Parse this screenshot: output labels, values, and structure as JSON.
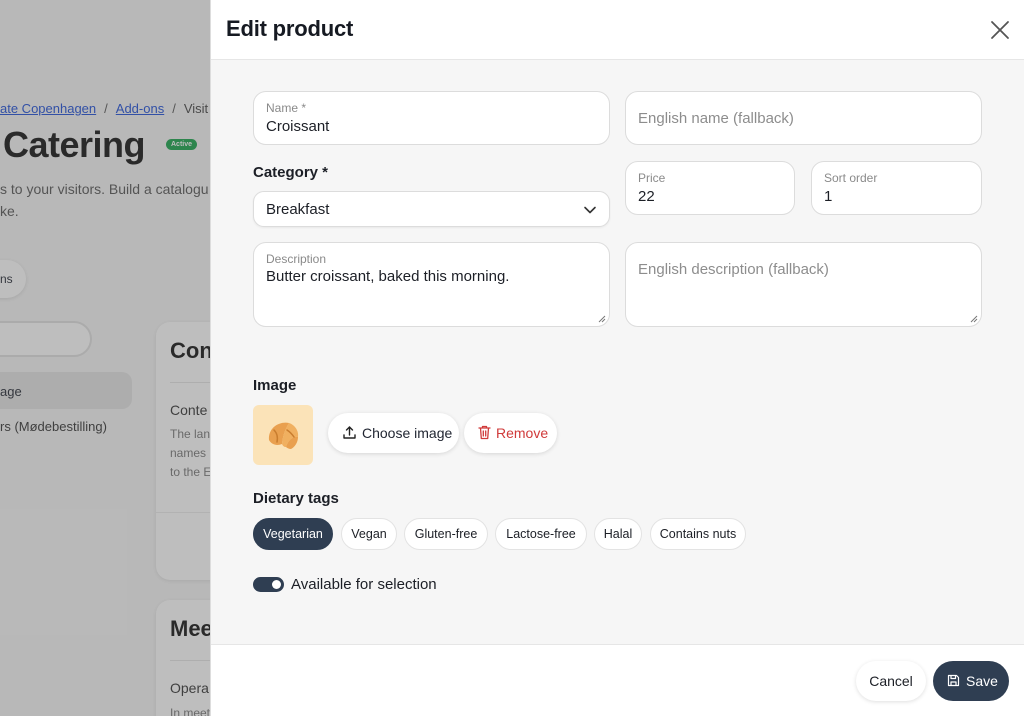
{
  "background": {
    "breadcrumb": {
      "crumb1": "ate Copenhagen",
      "crumb2": "Add-ons",
      "crumb3": "Visit",
      "separator": "/"
    },
    "title": "Catering",
    "badge": "Active",
    "intro_line1": "s to your visitors. Build a catalogu",
    "intro_line2": "ke.",
    "pill": "ns",
    "nav_active": "age",
    "nav_item": "rs (Mødebestilling)",
    "card1": {
      "title": "Con",
      "subtitle": "Conte",
      "line1": "The lan",
      "line2": "names",
      "line3": "to the E"
    },
    "card2": {
      "title": "Mee",
      "subtitle": "Opera",
      "line1": "In meet"
    }
  },
  "dialog": {
    "title": "Edit product",
    "name": {
      "label": "Name *",
      "value": "Croissant"
    },
    "english_name": {
      "placeholder": "English name (fallback)"
    },
    "category": {
      "label": "Category *",
      "value": "Breakfast"
    },
    "price": {
      "label": "Price",
      "value": "22"
    },
    "sort_order": {
      "label": "Sort order",
      "value": "1"
    },
    "description": {
      "label": "Description",
      "value": "Butter croissant, baked this morning."
    },
    "english_description": {
      "placeholder": "English description (fallback)"
    },
    "image": {
      "label": "Image",
      "choose_label": "Choose image",
      "remove_label": "Remove",
      "thumbnail_icon": "croissant-icon"
    },
    "dietary": {
      "label": "Dietary tags",
      "tags": [
        {
          "label": "Vegetarian",
          "selected": true
        },
        {
          "label": "Vegan",
          "selected": false
        },
        {
          "label": "Gluten-free",
          "selected": false
        },
        {
          "label": "Lactose-free",
          "selected": false
        },
        {
          "label": "Halal",
          "selected": false
        },
        {
          "label": "Contains nuts",
          "selected": false
        }
      ]
    },
    "available": {
      "label": "Available for selection",
      "checked": true
    },
    "footer": {
      "cancel_label": "Cancel",
      "save_label": "Save"
    }
  },
  "colors": {
    "primary": "#2f3e52",
    "danger": "#d03a3a",
    "badge": "#16a34a",
    "link": "#1d4ed8",
    "thumbnail_bg": "#fbe3b8",
    "croissant": "#e9a04f"
  }
}
